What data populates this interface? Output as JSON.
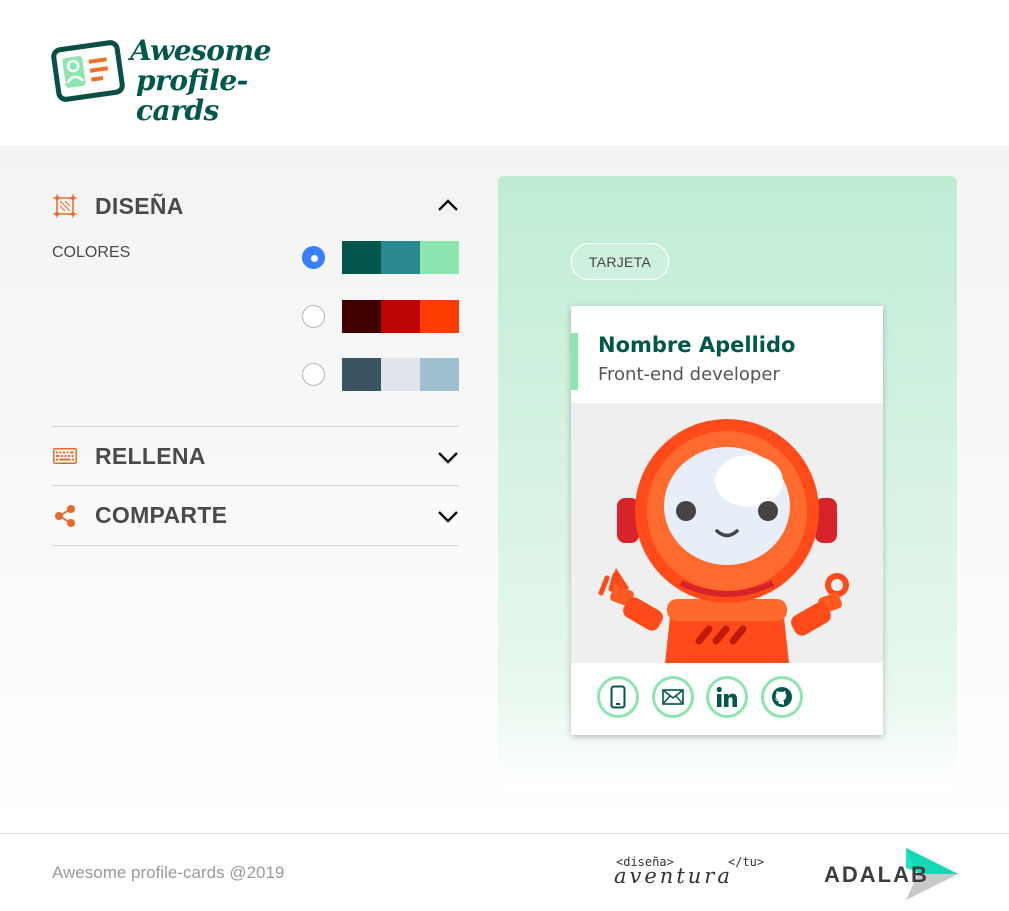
{
  "header": {
    "logo_line1": "Awesome",
    "logo_line2": "profile-cards"
  },
  "design": {
    "title": "DISEÑA",
    "icon": "crop-frame-icon",
    "expanded": true,
    "colors_label": "COLORES",
    "palettes": [
      {
        "selected": true,
        "colors": [
          "#03564c",
          "#2a8890",
          "#8de6b0"
        ]
      },
      {
        "selected": false,
        "colors": [
          "#420101",
          "#bd0404",
          "#fd3b01"
        ]
      },
      {
        "selected": false,
        "colors": [
          "#3a5561",
          "#e0e5ec",
          "#a0c0cf"
        ]
      }
    ]
  },
  "fill": {
    "title": "RELLENA",
    "icon": "keyboard-icon"
  },
  "share": {
    "title": "COMPARTE",
    "icon": "share-icon"
  },
  "preview": {
    "reset_label": "TARJETA",
    "card": {
      "name": "Nombre Apellido",
      "job": "Front-end developer",
      "accent": "#8de6b0",
      "name_color": "#00574b",
      "social": [
        "phone-icon",
        "mail-icon",
        "linkedin-icon",
        "github-icon"
      ]
    }
  },
  "footer": {
    "copyright": "Awesome profile-cards @2019",
    "aventura_top_left": "<diseña>",
    "aventura_top_right": "</tu>",
    "aventura_script": "aventura",
    "adalab": "ADALAB"
  }
}
